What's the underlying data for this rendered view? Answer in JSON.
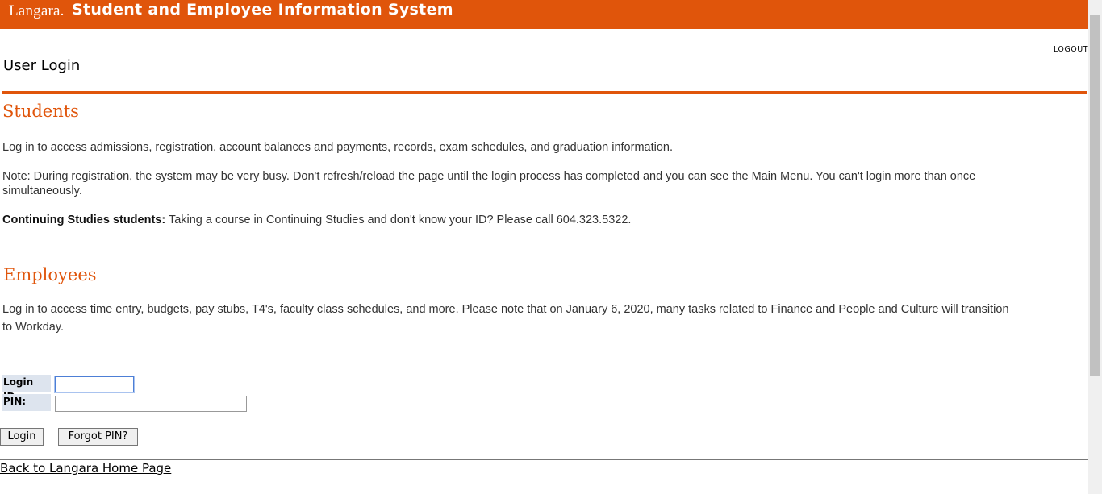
{
  "header": {
    "logo_text": "Langara.",
    "system_title": "Student and Employee Information System",
    "brand_color": "#e0550b"
  },
  "nav": {
    "logout": "LOGOUT"
  },
  "page": {
    "title": "User Login"
  },
  "students": {
    "heading": "Students",
    "intro": "Log in to access admissions, registration, account balances and payments, records, exam schedules, and graduation information.",
    "note_line1": "Note: During registration, the system may be very busy. Don't refresh/reload the page until the login process has completed and you can see the Main Menu. You can't login more than once",
    "note_line2": "simultaneously.",
    "cs_label": "Continuing Studies students:",
    "cs_text": " Taking a course in Continuing Studies and don't know your ID? Please call 604.323.5322."
  },
  "employees": {
    "heading": "Employees",
    "intro_line1": "Log in to access time entry, budgets, pay stubs, T4's, faculty class schedules, and more. Please note that on January 6, 2020, many tasks related to Finance and People and Culture will transition",
    "intro_line2": "to Workday."
  },
  "form": {
    "login_id_label": "Login ID:",
    "login_id_value": "",
    "pin_label": "PIN:",
    "pin_value": "",
    "login_button": "Login",
    "forgot_pin_button": "Forgot PIN?"
  },
  "footer": {
    "home_link": "Back to Langara Home Page"
  }
}
